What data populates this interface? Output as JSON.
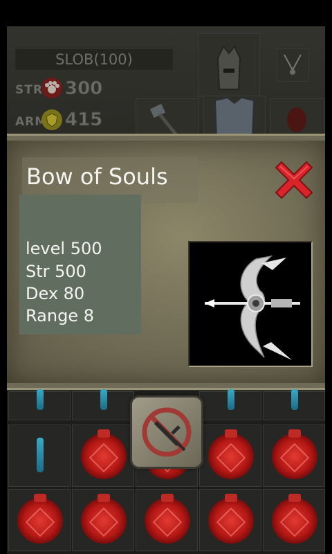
{
  "character": {
    "name": "SLOB(100)",
    "str_label": "STR",
    "str_value": "300",
    "arm_label": "ARM",
    "arm_value": "415"
  },
  "item": {
    "title": "Bow of Souls",
    "stats": [
      "level 500",
      "Str 500",
      "Dex 80",
      "Range 8"
    ]
  },
  "icons": {
    "close": "close-x-icon",
    "str": "paw-icon",
    "arm": "shield-icon",
    "disarm": "no-sword-icon",
    "potion": "red-potion-icon",
    "scroll": "blue-scroll-icon"
  },
  "colors": {
    "close": "#d9242a",
    "potion": "#c0201b",
    "dialog": "#787259"
  }
}
